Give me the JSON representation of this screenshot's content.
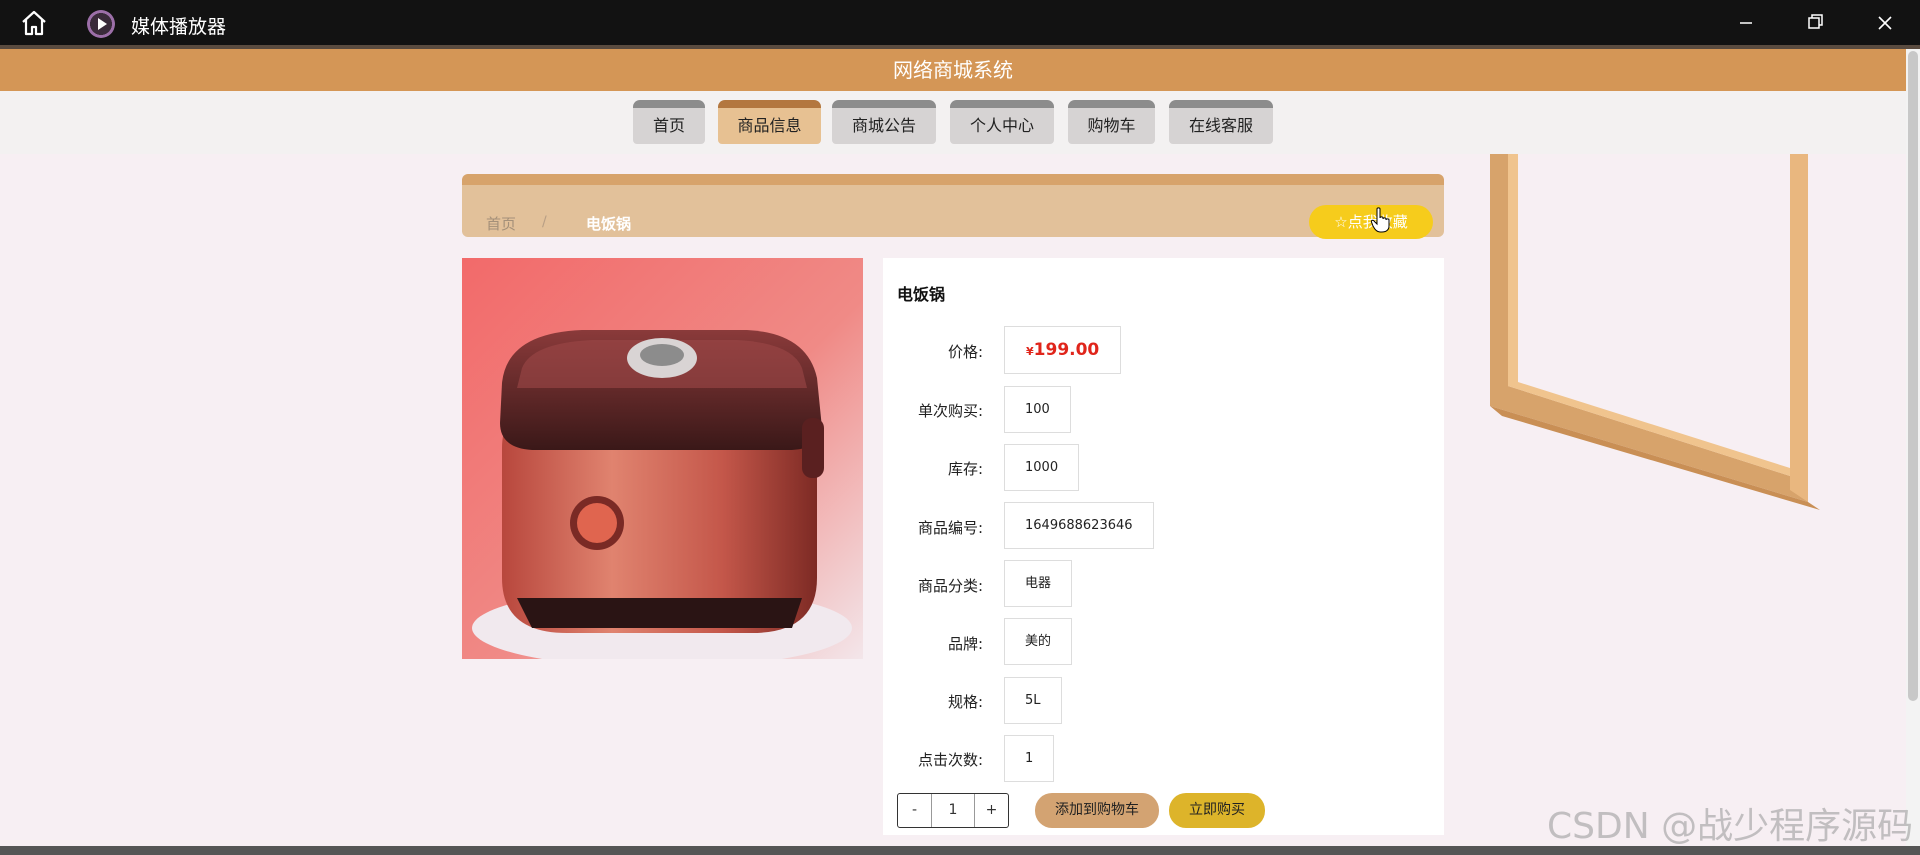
{
  "window": {
    "app_title": "媒体播放器"
  },
  "site": {
    "header_title": "网络商城系统"
  },
  "nav": {
    "items": [
      {
        "label": "首页"
      },
      {
        "label": "商品信息"
      },
      {
        "label": "商城公告"
      },
      {
        "label": "个人中心"
      },
      {
        "label": "购物车"
      },
      {
        "label": "在线客服"
      }
    ],
    "active_index": 1
  },
  "breadcrumb": {
    "home": "首页",
    "separator": "/",
    "current": "电饭锅"
  },
  "favorite_button": {
    "icon": "star-outline-icon",
    "label": "点我收藏"
  },
  "product": {
    "name": "电饭锅",
    "price_label": "价格:",
    "currency": "¥",
    "price": "199.00",
    "rows": [
      {
        "label": "单次购买:",
        "value": "100"
      },
      {
        "label": "库存:",
        "value": "1000"
      },
      {
        "label": "商品编号:",
        "value": "1649688623646"
      },
      {
        "label": "商品分类:",
        "value": "电器"
      },
      {
        "label": "品牌:",
        "value": "美的"
      },
      {
        "label": "规格:",
        "value": "5L"
      },
      {
        "label": "点击次数:",
        "value": "1"
      }
    ],
    "image_desc": "red-rice-cooker-photo"
  },
  "purchase": {
    "minus": "-",
    "quantity": "1",
    "plus": "+",
    "add_to_cart": "添加到购物车",
    "buy_now": "立即购买"
  },
  "watermark": "CSDN @战少程序源码",
  "colors": {
    "header_orange": "#d49656",
    "nav_active": "#e7c192",
    "crumb_bar": "#e2c19a",
    "favorite_yellow": "#f6cc1c",
    "price_red": "#e0251b",
    "cart_button": "#d3a372",
    "buy_button": "#ddb42a"
  }
}
